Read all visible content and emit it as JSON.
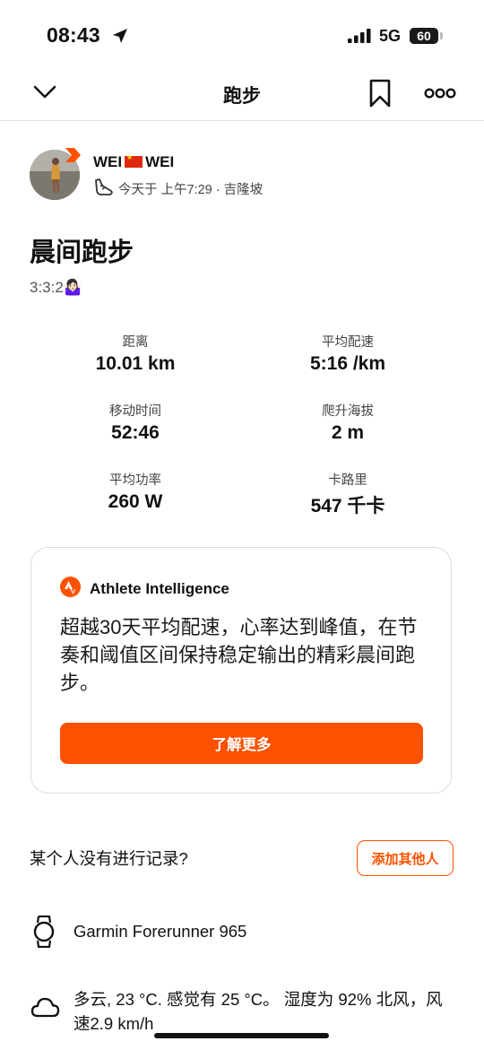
{
  "status_bar": {
    "time": "08:43",
    "network": "5G",
    "battery": "60",
    "battery_fraction": 0.6
  },
  "nav": {
    "title": "跑步",
    "back_icon": "chevron-down-icon",
    "bookmark_icon": "bookmark-icon",
    "more_icon": "more-dots-icon"
  },
  "athlete": {
    "name_first": "WEI",
    "name_last": "WEI",
    "meta": "今天于 上午7:29 · 吉隆坡",
    "shoe_icon": "running-shoe-icon"
  },
  "activity": {
    "title": "晨间跑步",
    "description": "3:3:2🤷🏻‍♀️"
  },
  "stats": [
    {
      "label": "距离",
      "value": "10.01 km"
    },
    {
      "label": "平均配速",
      "value": "5:16 /km"
    },
    {
      "label": "移动时间",
      "value": "52:46"
    },
    {
      "label": "爬升海拔",
      "value": "2 m"
    },
    {
      "label": "平均功率",
      "value": "260 W"
    },
    {
      "label": "卡路里",
      "value": "547 千卡"
    }
  ],
  "ai": {
    "title": "Athlete Intelligence",
    "text": "超越30天平均配速，心率达到峰值，在节奏和阈值区间保持稳定输出的精彩晨间跑步。",
    "button": "了解更多"
  },
  "record": {
    "question": "某个人没有进行记录?",
    "button": "添加其他人"
  },
  "device": {
    "name": "Garmin Forerunner 965",
    "icon": "watch-icon"
  },
  "weather": {
    "text": "多云, 23 °C. 感觉有 25 °C。 湿度为 92% 北风，风速2.9 km/h",
    "icon": "cloud-icon"
  },
  "colors": {
    "accent": "#fc5200",
    "text": "#111111",
    "muted": "#444444"
  }
}
